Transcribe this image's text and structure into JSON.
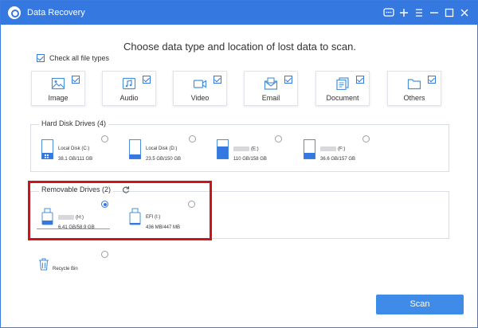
{
  "window": {
    "title": "Data Recovery",
    "controls": [
      "feedback-icon",
      "plus-icon",
      "menu-icon",
      "minimize-icon",
      "close-icon"
    ]
  },
  "heading": "Choose data type and location of lost data to scan.",
  "check_all": {
    "label": "Check all file types",
    "checked": true
  },
  "file_types": [
    {
      "label": "Image",
      "icon": "image-icon",
      "checked": true
    },
    {
      "label": "Audio",
      "icon": "audio-icon",
      "checked": true
    },
    {
      "label": "Video",
      "icon": "video-icon",
      "checked": true
    },
    {
      "label": "Email",
      "icon": "email-icon",
      "checked": true
    },
    {
      "label": "Document",
      "icon": "document-icon",
      "checked": true
    },
    {
      "label": "Others",
      "icon": "folder-icon",
      "checked": true
    }
  ],
  "hard_disk": {
    "title": "Hard Disk Drives (4)",
    "drives": [
      {
        "name": "Local Disk (C:)",
        "size": "38.1 GB/111 GB",
        "blurred_name": false,
        "selected": false
      },
      {
        "name": "Local Disk (D:)",
        "size": "23.5 GB/150 GB",
        "blurred_name": false,
        "selected": false
      },
      {
        "name": "(E:)",
        "size": "110 GB/158 GB",
        "blurred_name": true,
        "selected": false
      },
      {
        "name": "(F:)",
        "size": "36.6 GB/157 GB",
        "blurred_name": true,
        "selected": false
      }
    ]
  },
  "removable": {
    "title": "Removable Drives (2)",
    "refresh_icon": "refresh-icon",
    "drives": [
      {
        "name": "(H:)",
        "size": "6.41 GB/58.9 GB",
        "blurred_name": true,
        "selected": true
      },
      {
        "name": "EFI (I:)",
        "size": "436 MB/447 MB",
        "blurred_name": false,
        "selected": false
      }
    ]
  },
  "recycle_bin": {
    "label": "Recycle Bin",
    "icon": "trash-icon",
    "selected": false
  },
  "scan_button": "Scan",
  "colors": {
    "accent": "#3478e0",
    "highlight": "#d0121b",
    "button": "#3f8be8"
  }
}
